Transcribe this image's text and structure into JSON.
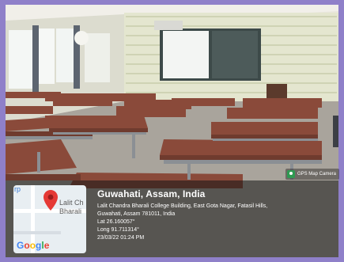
{
  "gps_badge": {
    "label": "GPS Map Camera",
    "icon": "gps-camera-icon"
  },
  "location": {
    "title": "Guwahati, Assam, India",
    "address_line1": "Lalit Chandra Bharali College Building, East Gota Nagar, Fatasil Hills,",
    "address_line2": "Guwahati, Assam 781011, India",
    "lat": "Lat 26.160057°",
    "long": "Long 91.711314°",
    "timestamp": "23/03/22 01:24 PM"
  },
  "map": {
    "place_label_1": "Lalit Ch",
    "place_label_2": "Bharali",
    "corner_label": "rp",
    "logo": "Google",
    "pin_color": "#e53935"
  }
}
